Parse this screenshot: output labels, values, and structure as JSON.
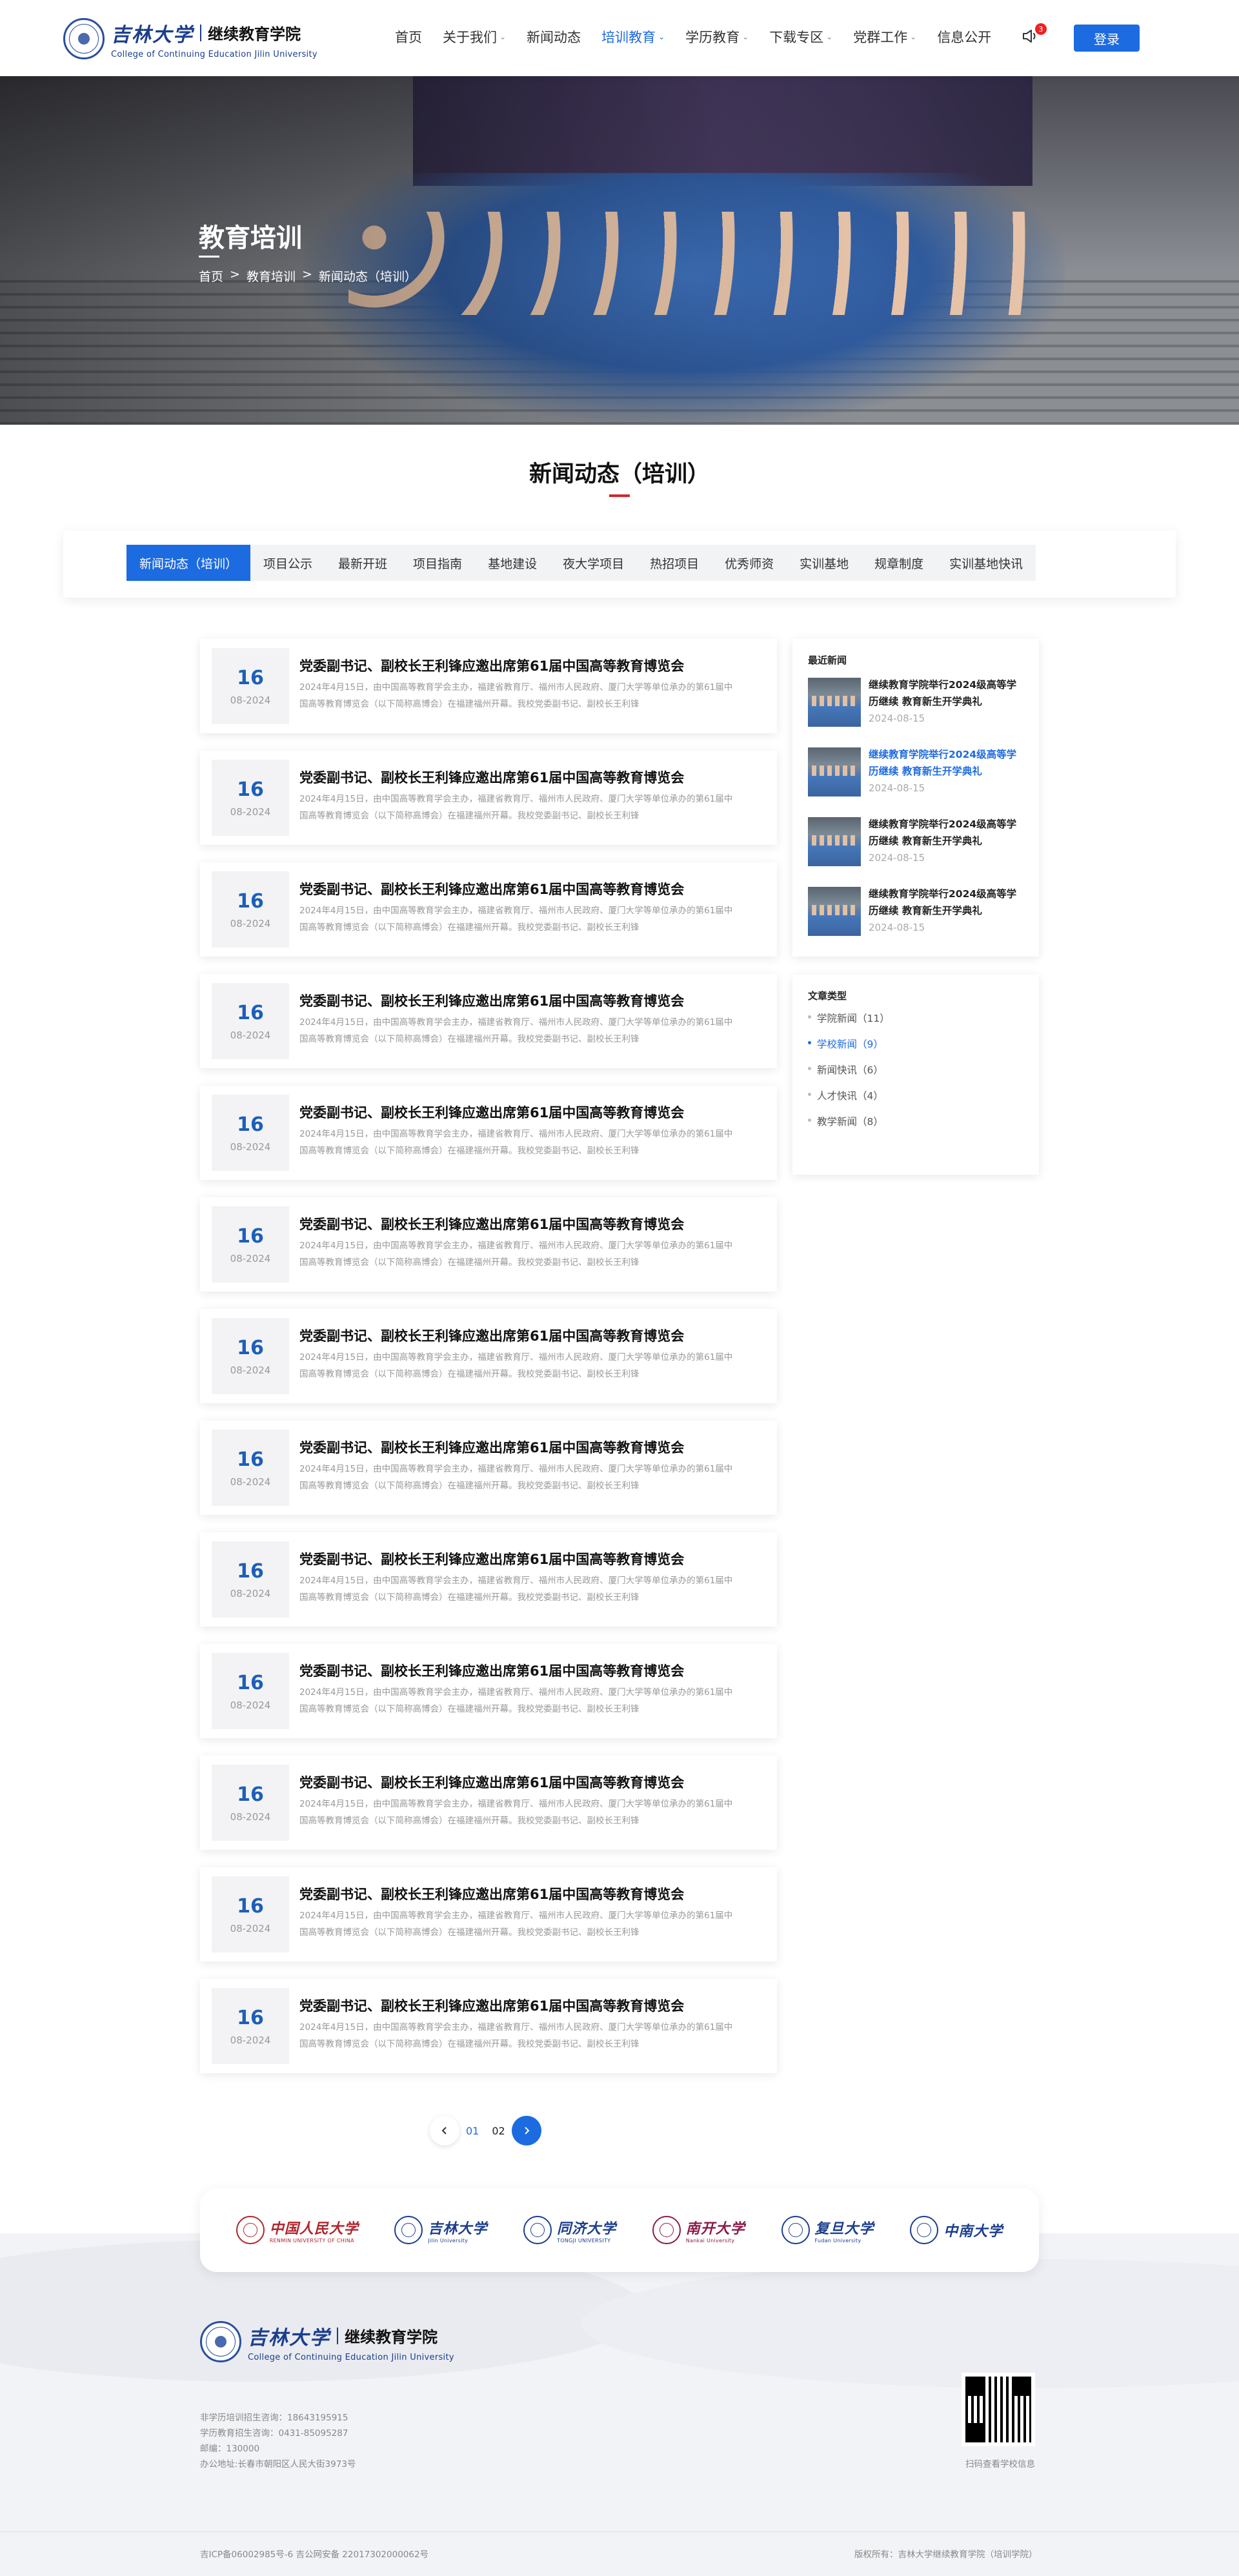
{
  "header": {
    "logo": {
      "script_name": "吉林大学",
      "school_name": "继续教育学院",
      "english_name": "College of Continuing Education Jilin University"
    },
    "nav": [
      {
        "label": "首页",
        "dropdown": false,
        "active": false
      },
      {
        "label": "关于我们",
        "dropdown": true,
        "active": false
      },
      {
        "label": "新闻动态",
        "dropdown": false,
        "active": false
      },
      {
        "label": "培训教育",
        "dropdown": true,
        "active": true
      },
      {
        "label": "学历教育",
        "dropdown": true,
        "active": false
      },
      {
        "label": "下载专区",
        "dropdown": true,
        "active": false
      },
      {
        "label": "党群工作",
        "dropdown": true,
        "active": false
      },
      {
        "label": "信息公开",
        "dropdown": false,
        "active": false
      }
    ],
    "notification_count": "3",
    "login_label": "登录"
  },
  "banner": {
    "title": "教育培训",
    "breadcrumb": [
      "首页",
      ">",
      "教育培训",
      ">",
      "新闻动态（培训）"
    ]
  },
  "section_title": "新闻动态（培训）",
  "tabs": [
    {
      "label": "新闻动态（培训）",
      "active": true
    },
    {
      "label": "项目公示",
      "active": false
    },
    {
      "label": "最新开班",
      "active": false
    },
    {
      "label": "项目指南",
      "active": false
    },
    {
      "label": "基地建设",
      "active": false
    },
    {
      "label": "夜大学项目",
      "active": false
    },
    {
      "label": "热招项目",
      "active": false
    },
    {
      "label": "优秀师资",
      "active": false
    },
    {
      "label": "实训基地",
      "active": false
    },
    {
      "label": "规章制度",
      "active": false
    },
    {
      "label": "实训基地快讯",
      "active": false
    }
  ],
  "articles": [
    {
      "day": "16",
      "ym": "08-2024",
      "title": "党委副书记、副校长王利锋应邀出席第61届中国高等教育博览会",
      "desc": "2024年4月15日，由中国高等教育学会主办，福建省教育厅、福州市人民政府、厦门大学等单位承办的第61届中国高等教育博览会（以下简称高博会）在福建福州开幕。我校党委副书记、副校长王利锋"
    },
    {
      "day": "16",
      "ym": "08-2024",
      "title": "党委副书记、副校长王利锋应邀出席第61届中国高等教育博览会",
      "desc": "2024年4月15日，由中国高等教育学会主办，福建省教育厅、福州市人民政府、厦门大学等单位承办的第61届中国高等教育博览会（以下简称高博会）在福建福州开幕。我校党委副书记、副校长王利锋"
    },
    {
      "day": "16",
      "ym": "08-2024",
      "title": "党委副书记、副校长王利锋应邀出席第61届中国高等教育博览会",
      "desc": "2024年4月15日，由中国高等教育学会主办，福建省教育厅、福州市人民政府、厦门大学等单位承办的第61届中国高等教育博览会（以下简称高博会）在福建福州开幕。我校党委副书记、副校长王利锋"
    },
    {
      "day": "16",
      "ym": "08-2024",
      "title": "党委副书记、副校长王利锋应邀出席第61届中国高等教育博览会",
      "desc": "2024年4月15日，由中国高等教育学会主办，福建省教育厅、福州市人民政府、厦门大学等单位承办的第61届中国高等教育博览会（以下简称高博会）在福建福州开幕。我校党委副书记、副校长王利锋"
    },
    {
      "day": "16",
      "ym": "08-2024",
      "title": "党委副书记、副校长王利锋应邀出席第61届中国高等教育博览会",
      "desc": "2024年4月15日，由中国高等教育学会主办，福建省教育厅、福州市人民政府、厦门大学等单位承办的第61届中国高等教育博览会（以下简称高博会）在福建福州开幕。我校党委副书记、副校长王利锋"
    },
    {
      "day": "16",
      "ym": "08-2024",
      "title": "党委副书记、副校长王利锋应邀出席第61届中国高等教育博览会",
      "desc": "2024年4月15日，由中国高等教育学会主办，福建省教育厅、福州市人民政府、厦门大学等单位承办的第61届中国高等教育博览会（以下简称高博会）在福建福州开幕。我校党委副书记、副校长王利锋"
    },
    {
      "day": "16",
      "ym": "08-2024",
      "title": "党委副书记、副校长王利锋应邀出席第61届中国高等教育博览会",
      "desc": "2024年4月15日，由中国高等教育学会主办，福建省教育厅、福州市人民政府、厦门大学等单位承办的第61届中国高等教育博览会（以下简称高博会）在福建福州开幕。我校党委副书记、副校长王利锋"
    },
    {
      "day": "16",
      "ym": "08-2024",
      "title": "党委副书记、副校长王利锋应邀出席第61届中国高等教育博览会",
      "desc": "2024年4月15日，由中国高等教育学会主办，福建省教育厅、福州市人民政府、厦门大学等单位承办的第61届中国高等教育博览会（以下简称高博会）在福建福州开幕。我校党委副书记、副校长王利锋"
    },
    {
      "day": "16",
      "ym": "08-2024",
      "title": "党委副书记、副校长王利锋应邀出席第61届中国高等教育博览会",
      "desc": "2024年4月15日，由中国高等教育学会主办，福建省教育厅、福州市人民政府、厦门大学等单位承办的第61届中国高等教育博览会（以下简称高博会）在福建福州开幕。我校党委副书记、副校长王利锋"
    },
    {
      "day": "16",
      "ym": "08-2024",
      "title": "党委副书记、副校长王利锋应邀出席第61届中国高等教育博览会",
      "desc": "2024年4月15日，由中国高等教育学会主办，福建省教育厅、福州市人民政府、厦门大学等单位承办的第61届中国高等教育博览会（以下简称高博会）在福建福州开幕。我校党委副书记、副校长王利锋"
    },
    {
      "day": "16",
      "ym": "08-2024",
      "title": "党委副书记、副校长王利锋应邀出席第61届中国高等教育博览会",
      "desc": "2024年4月15日，由中国高等教育学会主办，福建省教育厅、福州市人民政府、厦门大学等单位承办的第61届中国高等教育博览会（以下简称高博会）在福建福州开幕。我校党委副书记、副校长王利锋"
    },
    {
      "day": "16",
      "ym": "08-2024",
      "title": "党委副书记、副校长王利锋应邀出席第61届中国高等教育博览会",
      "desc": "2024年4月15日，由中国高等教育学会主办，福建省教育厅、福州市人民政府、厦门大学等单位承办的第61届中国高等教育博览会（以下简称高博会）在福建福州开幕。我校党委副书记、副校长王利锋"
    },
    {
      "day": "16",
      "ym": "08-2024",
      "title": "党委副书记、副校长王利锋应邀出席第61届中国高等教育博览会",
      "desc": "2024年4月15日，由中国高等教育学会主办，福建省教育厅、福州市人民政府、厦门大学等单位承办的第61届中国高等教育博览会（以下简称高博会）在福建福州开幕。我校党委副书记、副校长王利锋"
    }
  ],
  "sidebar": {
    "recent_heading": "最近新闻",
    "recent": [
      {
        "title": "继续教育学院举行2024级高等学历继续 教育新生开学典礼",
        "date": "2024-08-15",
        "active": false
      },
      {
        "title": "继续教育学院举行2024级高等学历继续 教育新生开学典礼",
        "date": "2024-08-15",
        "active": true
      },
      {
        "title": "继续教育学院举行2024级高等学历继续 教育新生开学典礼",
        "date": "2024-08-15",
        "active": false
      },
      {
        "title": "继续教育学院举行2024级高等学历继续 教育新生开学典礼",
        "date": "2024-08-15",
        "active": false
      }
    ],
    "category_heading": "文章类型",
    "categories": [
      {
        "label": "学院新闻（11）",
        "active": false
      },
      {
        "label": "学校新闻（9）",
        "active": true
      },
      {
        "label": "新闻快讯（6）",
        "active": false
      },
      {
        "label": "人才快讯（4）",
        "active": false
      },
      {
        "label": "教学新闻（8）",
        "active": false
      }
    ]
  },
  "pagination": {
    "prev_icon": "chevron-left-icon",
    "pages": [
      "01",
      "02"
    ],
    "current": "01",
    "next_icon": "chevron-right-icon"
  },
  "partners": [
    {
      "cn": "中国人民大学",
      "en": "RENMIN UNIVERSITY OF CHINA",
      "color": "#b0262c"
    },
    {
      "cn": "吉林大学",
      "en": "Jilin University",
      "color": "#1b3e8d"
    },
    {
      "cn": "同济大学",
      "en": "TONGJI UNIVERSITY",
      "color": "#1b3e8d"
    },
    {
      "cn": "南开大学",
      "en": "Nankai University",
      "color": "#8b1a4a"
    },
    {
      "cn": "复旦大学",
      "en": "Fudan University",
      "color": "#1b3e8d"
    },
    {
      "cn": "中南大学",
      "en": "",
      "color": "#1b3e8d"
    }
  ],
  "footer": {
    "logo": {
      "script_name": "吉林大学",
      "school_name": "继续教育学院",
      "english_name": "College of Continuing Education Jilin University"
    },
    "info": [
      "非学历培训招生咨询：18643195915",
      "学历教育招生咨询：0431-85095287",
      "邮编：130000",
      "办公地址:长春市朝阳区人民大街3973号"
    ],
    "qr_caption": "扫码查看学校信息",
    "icp": "吉ICP备06002985号-6 吉公网安备 22017302000062号",
    "copyright": "版权所有：吉林大学继续教育学院（培训学院）"
  },
  "colors": {
    "primary": "#1d6be0",
    "accent_red": "#d8222a",
    "date_blue": "#1d5fb8"
  }
}
